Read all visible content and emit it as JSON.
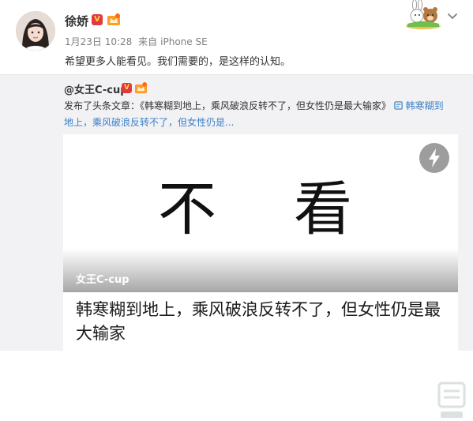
{
  "post": {
    "username": "徐娇",
    "verified_badge": "V",
    "time": "1月23日 10:28",
    "source_prefix": "来自",
    "source": "iPhone SE",
    "text": "希望更多人能看见。我们需要的，是这样的认知。"
  },
  "repost": {
    "original_user": "@女王C-cup",
    "verified_badge": "V",
    "text_prefix": "发布了头条文章：《韩寒糊到地上，乘风破浪反转不了，但女性仍是最大输家》",
    "link_icon": "article-link-icon",
    "link_text_line1": "韩寒糊到",
    "link_text_line2": "地上，乘风破浪反转不了，但女性仍是..."
  },
  "card": {
    "image_char_1": "不",
    "image_char_2": "看",
    "image_author": "女王C-cup",
    "title": "韩寒糊到地上，乘风破浪反转不了，但女性仍是最大输家"
  },
  "icons": {
    "mascot": "rabbit-bear-mascot-icon",
    "menu": "chevron-down-icon",
    "flash": "lightning-icon",
    "vip": "vip-crown-icon"
  },
  "colors": {
    "link": "#3a7fc6",
    "verified_red": "#e2393f",
    "repost_bg": "#f2f2f5"
  }
}
